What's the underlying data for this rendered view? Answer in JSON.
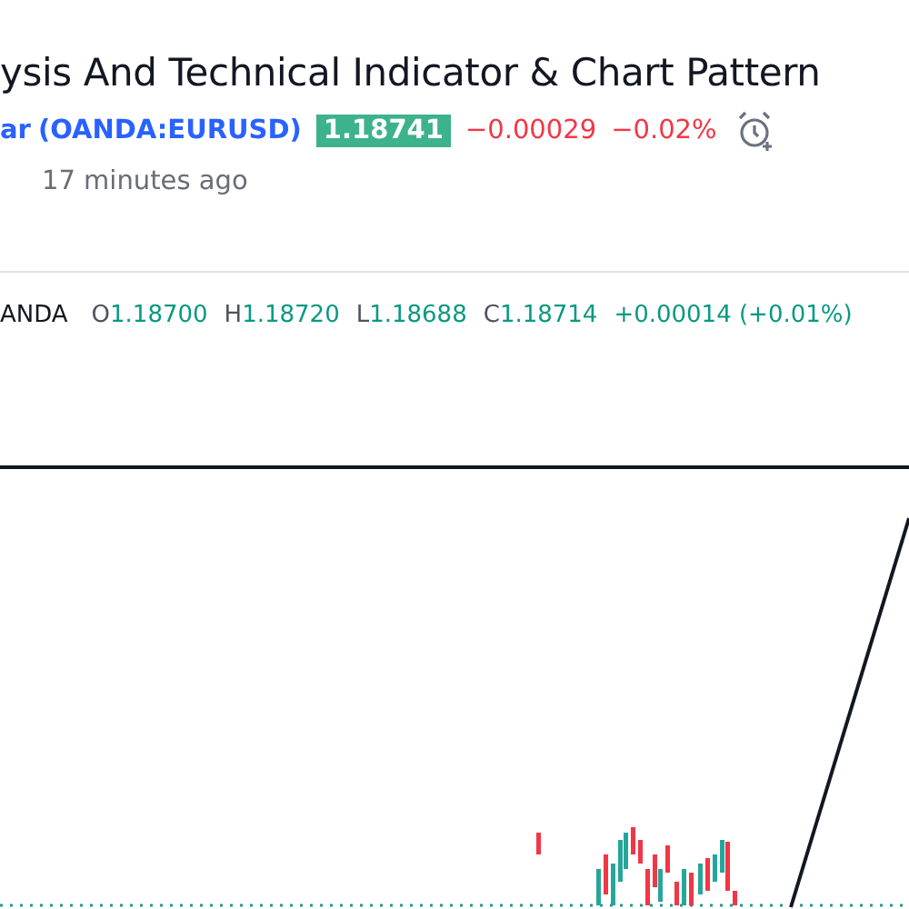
{
  "title": "ysis And Technical Indicator & Chart Pattern",
  "symbol": {
    "name": "ar",
    "ticker": "(OANDA:EURUSD)",
    "price": "1.18741",
    "change": "−0.00029",
    "change_percent": "−0.02%"
  },
  "published": "17 minutes ago",
  "legend": {
    "source": "ANDA",
    "items": [
      {
        "label": "O",
        "value": "1.18700"
      },
      {
        "label": "H",
        "value": "1.18720"
      },
      {
        "label": "L",
        "value": "1.18688"
      },
      {
        "label": "C",
        "value": "1.18714"
      }
    ],
    "change": "+0.00014 (+0.01%)"
  }
}
